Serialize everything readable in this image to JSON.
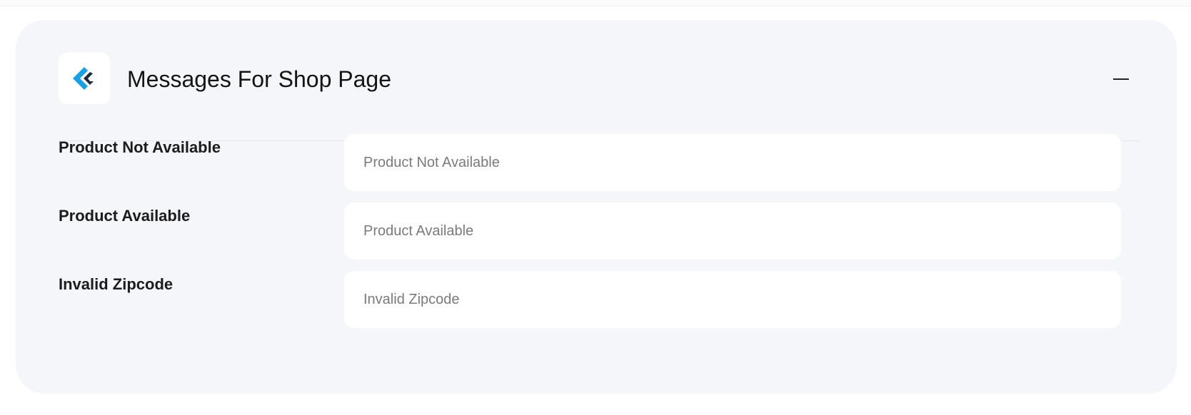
{
  "section": {
    "title": "Messages For Shop Page",
    "logo_icon": "brand-logo-icon",
    "collapse_icon": "minus-icon",
    "colors": {
      "card_background": "#f5f6fa",
      "logo_blue": "#1a9fe0",
      "logo_dark": "#1e2a3a"
    }
  },
  "fields": [
    {
      "label": "Product Not Available",
      "placeholder": "Product Not Available",
      "value": ""
    },
    {
      "label": "Product Available",
      "placeholder": "Product Available",
      "value": ""
    },
    {
      "label": "Invalid Zipcode",
      "placeholder": "Invalid Zipcode",
      "value": ""
    }
  ]
}
